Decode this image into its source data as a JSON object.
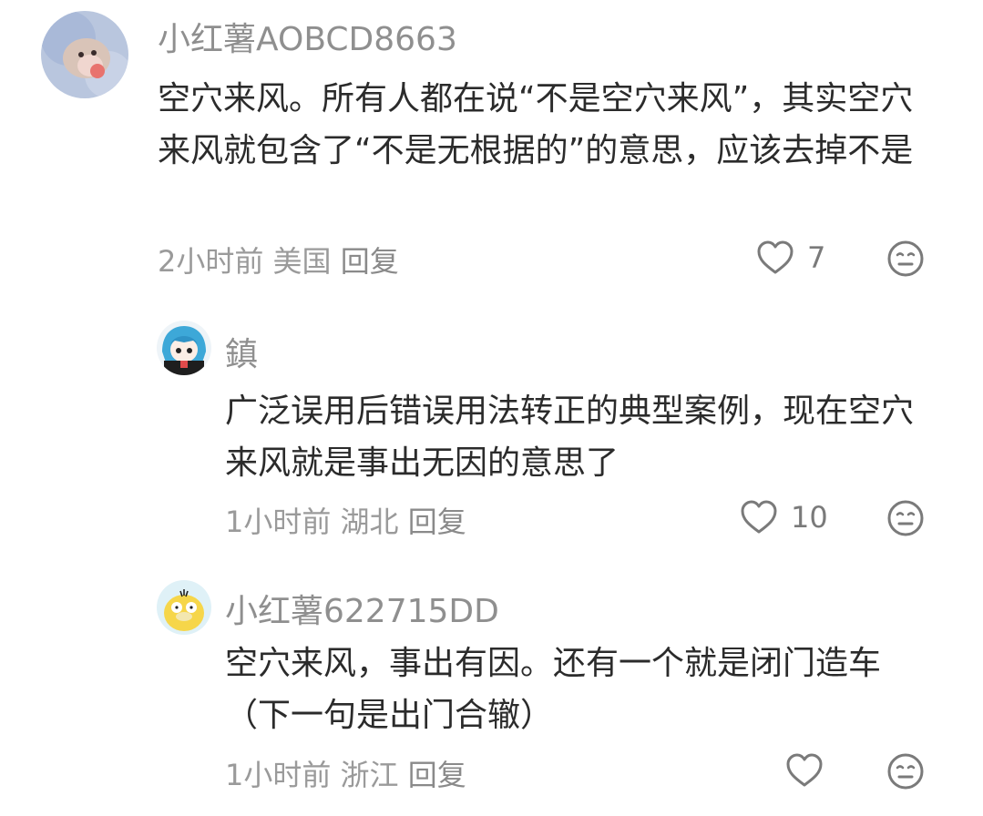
{
  "comments": [
    {
      "username": "小红薯AOBCD8663",
      "text": "空穴来风。所有人都在说“不是空穴来风”，其实空穴来风就包含了“不是无根据的”的意思，应该去掉不是",
      "time": "2小时前",
      "location": "美国",
      "reply_label": "回复",
      "likes": "7",
      "avatar_icon": "hamster-avatar-icon"
    },
    {
      "username": "鎮",
      "text": "广泛误用后错误用法转正的典型案例，现在空穴来风就是事出无因的意思了",
      "time": "1小时前",
      "location": "湖北",
      "reply_label": "回复",
      "likes": "10",
      "avatar_icon": "anime-girl-avatar-icon"
    },
    {
      "username": "小红薯622715DD",
      "text": "空穴来风，事出有因。还有一个就是闭门造车（下一句是出门合辙）",
      "time": "1小时前",
      "location": "浙江",
      "reply_label": "回复",
      "likes": "",
      "avatar_icon": "psyduck-avatar-icon"
    }
  ],
  "icons": {
    "like": "heart-outline-icon",
    "emoji": "neutral-face-icon"
  },
  "colors": {
    "username": "#8f8f8f",
    "text": "#2b2b2b",
    "meta": "#9a9a9a",
    "icon": "#7a7a7a"
  }
}
